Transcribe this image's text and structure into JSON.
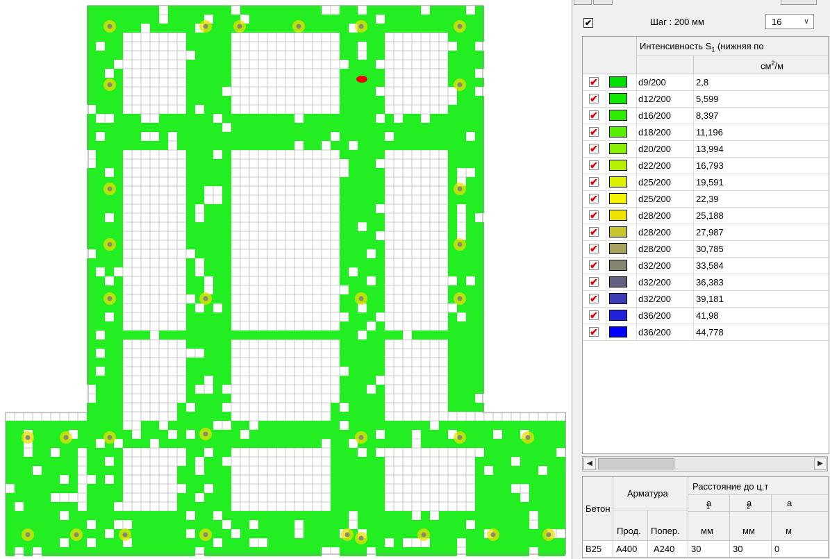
{
  "header": {
    "enabled_check": "✔",
    "step_label": "Шаг : 200 мм",
    "step_value": "16",
    "column_title": "Интенсивность S",
    "column_title_sub": "1",
    "column_title_rest": " (нижняя по",
    "unit_main": "см",
    "unit_sup": "2",
    "unit_rest": "/м"
  },
  "legend_rows": [
    {
      "label": "d9/200",
      "value": "2,8",
      "color": "#00e000"
    },
    {
      "label": "d12/200",
      "value": "5,599",
      "color": "#10e800"
    },
    {
      "label": "d16/200",
      "value": "8,397",
      "color": "#30ec00"
    },
    {
      "label": "d18/200",
      "value": "11,196",
      "color": "#58ee00"
    },
    {
      "label": "d20/200",
      "value": "13,994",
      "color": "#88f000"
    },
    {
      "label": "d22/200",
      "value": "16,793",
      "color": "#b4f000"
    },
    {
      "label": "d25/200",
      "value": "19,591",
      "color": "#dcf000"
    },
    {
      "label": "d25/200",
      "value": "22,39",
      "color": "#f4f400"
    },
    {
      "label": "d28/200",
      "value": "25,188",
      "color": "#ece400"
    },
    {
      "label": "d28/200",
      "value": "27,987",
      "color": "#c8c430"
    },
    {
      "label": "d28/200",
      "value": "30,785",
      "color": "#a8a460"
    },
    {
      "label": "d32/200",
      "value": "33,584",
      "color": "#868670"
    },
    {
      "label": "d32/200",
      "value": "36,383",
      "color": "#606080"
    },
    {
      "label": "d32/200",
      "value": "39,181",
      "color": "#3c3cb4"
    },
    {
      "label": "d36/200",
      "value": "41,98",
      "color": "#2222dc"
    },
    {
      "label": "d36/200",
      "value": "44,778",
      "color": "#0000ff"
    }
  ],
  "bottom_table": {
    "concrete_header": "Бетон",
    "rebar_header": "Арматура",
    "distance_header": "Расстояние до ц.т",
    "long_header": "Прод.",
    "trans_header": "Попер.",
    "a1_main": "a",
    "a1_sub": "1",
    "a2_main": "a",
    "a2_sub": "2",
    "a3_main": "a",
    "unit_mm": "мм",
    "unit_mm_2": "мм",
    "unit_mm_3": "м",
    "concrete": "B25",
    "long": "A400",
    "trans": "A240",
    "a1": "30",
    "a2": "30",
    "a3": "0"
  },
  "plot": {
    "mesh_color": "#b8b8b8",
    "zone_color": "#22ee22",
    "hotspot_color": "#e8e000",
    "marker_color": "#ee0000"
  }
}
